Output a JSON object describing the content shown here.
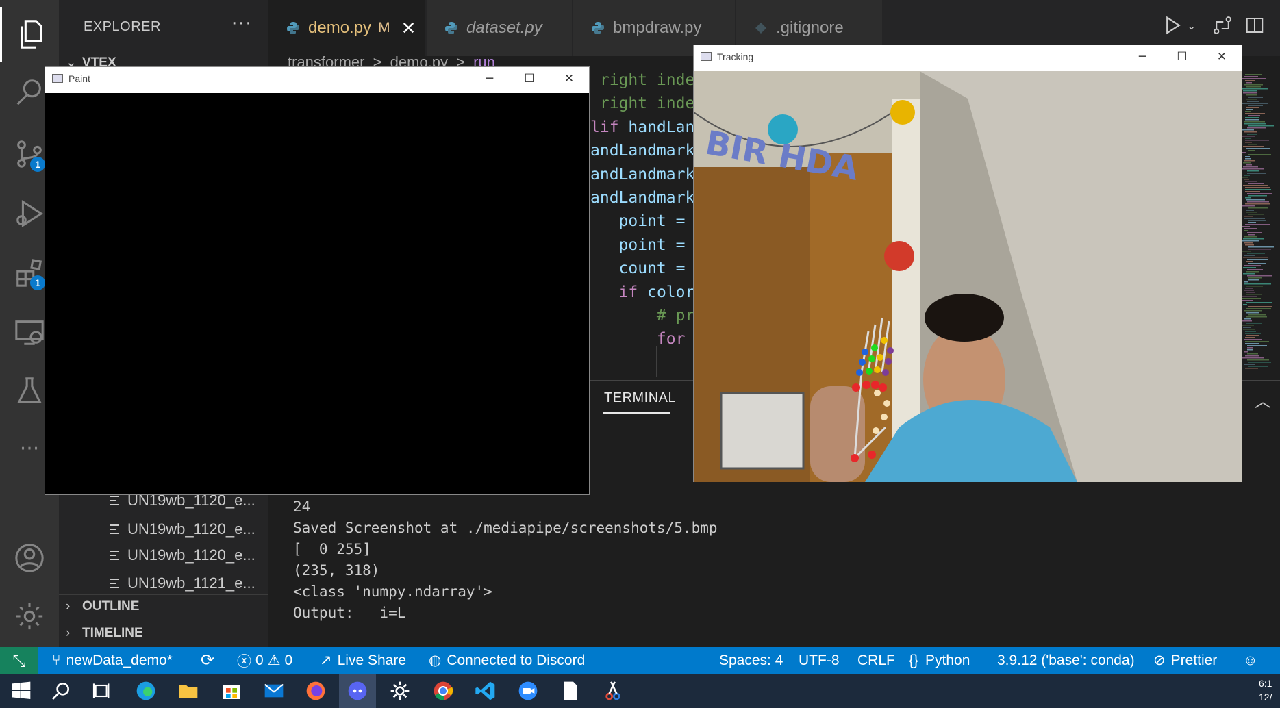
{
  "activity_bar": {
    "items": [
      {
        "icon": "explorer-icon"
      },
      {
        "icon": "search-icon"
      },
      {
        "icon": "source-control-icon",
        "badge": "1"
      },
      {
        "icon": "run-debug-icon"
      },
      {
        "icon": "extensions-icon",
        "badge": "1"
      },
      {
        "icon": "remote-explorer-icon"
      },
      {
        "icon": "testing-icon"
      },
      {
        "icon": "more-icon"
      },
      {
        "icon": "account-icon"
      },
      {
        "icon": "settings-gear-icon"
      }
    ]
  },
  "sidebar": {
    "title": "EXPLORER",
    "more": "···",
    "folder": "VTEX",
    "files": [
      "UN19wb_1120_e...",
      "UN19wb_1120_e...",
      "UN19wb_1120_e...",
      "UN19wb_1121_e..."
    ],
    "outline": "OUTLINE",
    "timeline": "TIMELINE"
  },
  "tabs": [
    {
      "label": "demo.py",
      "modified": "M",
      "active": true
    },
    {
      "label": "dataset.py",
      "italic": true
    },
    {
      "label": "bmpdraw.py"
    },
    {
      "label": ".gitignore"
    }
  ],
  "breadcrumb": {
    "folder": "transformer",
    "file": "demo.py",
    "symbol": "run",
    "sep": ">"
  },
  "code_lines": [
    {
      "c": "cm",
      "t": " right inde"
    },
    {
      "c": "cm",
      "t": " right inde"
    },
    {
      "c": "kw",
      "t": "lif",
      "r": " handLan"
    },
    {
      "c": "vr",
      "t": "andLandmark"
    },
    {
      "c": "vr",
      "t": "andLandmark"
    },
    {
      "c": "vr",
      "t": "andLandmark"
    },
    {
      "c": "vr",
      "t": "   point =",
      "r": ""
    },
    {
      "c": "vr",
      "t": "   point =",
      "r": ""
    },
    {
      "c": "vr",
      "t": "   count =",
      "r": ""
    },
    {
      "c": "kw",
      "t": "   if",
      "r": " color"
    },
    {
      "c": "cm",
      "t": "       # pr"
    },
    {
      "c": "kw",
      "t": "       for"
    }
  ],
  "terminal": {
    "tab": "TERMINAL",
    "lines": [
      "24",
      "Saved Screenshot at ./mediapipe/screenshots/5.bmp",
      "[  0 255]",
      "(235, 318)",
      "<class 'numpy.ndarray'>",
      "Output:   i=L"
    ]
  },
  "statusbar": {
    "branch": "newData_demo*",
    "errors": "0",
    "warnings": "0",
    "live_share": "Live Share",
    "discord": "Connected to Discord",
    "spaces": "Spaces: 4",
    "encoding": "UTF-8",
    "eol": "CRLF",
    "language": "Python",
    "interpreter": "3.9.12 ('base': conda)",
    "prettier": "Prettier"
  },
  "paint_window": {
    "title": "Paint"
  },
  "tracking_window": {
    "title": "Tracking",
    "banner": "BIR HDA"
  },
  "clock": {
    "time": "6:1",
    "date": "12/"
  },
  "taskbar": {
    "items": [
      "start-icon",
      "search-icon",
      "task-view-icon",
      "edge-icon",
      "file-explorer-icon",
      "store-icon",
      "mail-icon",
      "firefox-icon",
      "discord-icon",
      "settings-icon",
      "chrome-icon",
      "vscode-icon",
      "zoom-icon",
      "notepad-icon",
      "snipping-tool-icon"
    ]
  }
}
